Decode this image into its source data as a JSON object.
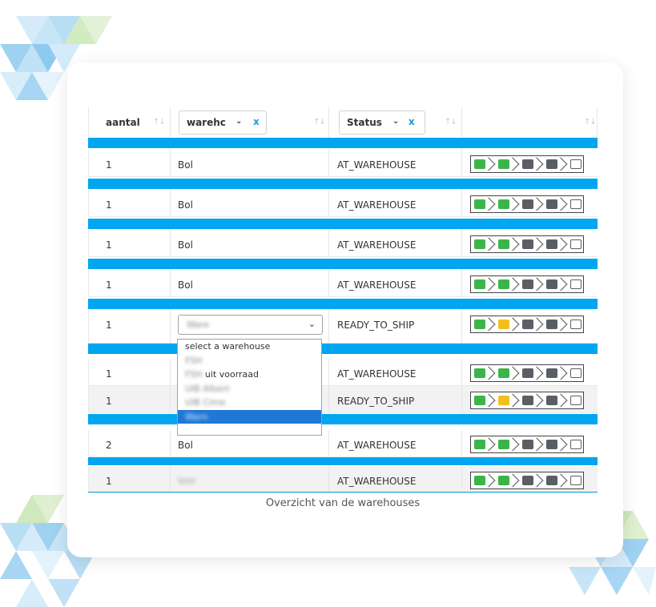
{
  "table": {
    "headers": {
      "aantal": "aantal",
      "warehouse_filter": "warehc",
      "status_filter": "Status",
      "clear": "x",
      "sort": "↑↓"
    },
    "rows": [
      {
        "aantal": "1",
        "warehouse": "Bol",
        "status": "AT_WAREHOUSE",
        "progress": [
          "green",
          "green",
          "dark",
          "dark",
          "outline"
        ]
      },
      {
        "aantal": "1",
        "warehouse": "Bol",
        "status": "AT_WAREHOUSE",
        "progress": [
          "green",
          "green",
          "dark",
          "dark",
          "outline"
        ]
      },
      {
        "aantal": "1",
        "warehouse": "Bol",
        "status": "AT_WAREHOUSE",
        "progress": [
          "green",
          "green",
          "dark",
          "dark",
          "outline"
        ]
      },
      {
        "aantal": "1",
        "warehouse": "Bol",
        "status": "AT_WAREHOUSE",
        "progress": [
          "green",
          "green",
          "dark",
          "dark",
          "outline"
        ]
      },
      {
        "aantal": "1",
        "warehouse": "Ware",
        "status": "READY_TO_SHIP",
        "progress": [
          "green",
          "yellow",
          "dark",
          "dark",
          "outline"
        ]
      },
      {
        "aantal": "1",
        "warehouse": "",
        "status": "AT_WAREHOUSE",
        "progress": [
          "green",
          "green",
          "dark",
          "dark",
          "outline"
        ]
      },
      {
        "aantal": "1",
        "warehouse": "",
        "status": "READY_TO_SHIP",
        "progress": [
          "green",
          "yellow",
          "dark",
          "dark",
          "outline"
        ]
      },
      {
        "aantal": "2",
        "warehouse": "Bol",
        "status": "AT_WAREHOUSE",
        "progress": [
          "green",
          "green",
          "dark",
          "dark",
          "outline"
        ]
      },
      {
        "aantal": "1",
        "warehouse": "Vrrr",
        "status": "AT_WAREHOUSE",
        "progress": [
          "green",
          "green",
          "dark",
          "dark",
          "outline"
        ]
      }
    ]
  },
  "dropdown": {
    "selected": "Ware",
    "options": [
      {
        "prefix": "select a warehouse",
        "blurred": ""
      },
      {
        "prefix": "",
        "blurred": "FSH"
      },
      {
        "prefix": "",
        "blurred": "FSH",
        "suffix": " uit voorraad"
      },
      {
        "prefix": "",
        "blurred": "UIB Albert"
      },
      {
        "prefix": "",
        "blurred": "UIB Cime"
      },
      {
        "prefix": "",
        "blurred": "Warn",
        "selected": true
      }
    ]
  },
  "caption": "Overzicht van de warehouses",
  "colors": {
    "band": "#00a6ef",
    "green": "#3bb54a",
    "yellow": "#f2c01e",
    "dark": "#5a5f66",
    "selected_option": "#1f78d6"
  },
  "icons": [
    "basket-icon",
    "box-icon",
    "truck-icon",
    "document-icon",
    "check-icon"
  ]
}
